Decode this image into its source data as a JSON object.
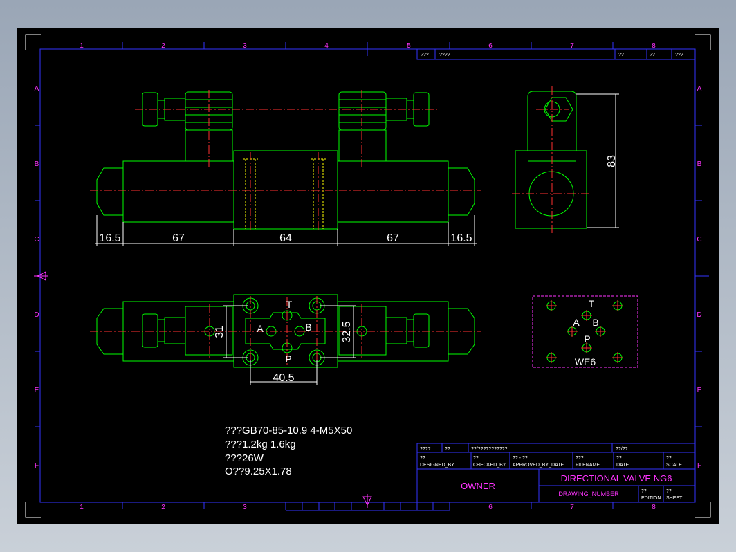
{
  "zone_numbers": [
    "1",
    "2",
    "3",
    "4",
    "5",
    "6",
    "7",
    "8"
  ],
  "zone_letters": [
    "A",
    "B",
    "C",
    "D",
    "E",
    "F"
  ],
  "title_top": {
    "c1": "???",
    "c2": "????",
    "c3": "??",
    "c4": "??",
    "c5": "???"
  },
  "dimensions": {
    "front": [
      "16.5",
      "67",
      "64",
      "67",
      "16.5"
    ],
    "side_height": "83",
    "plan_31": "31",
    "plan_32_5": "32.5",
    "plan_40_5": "40.5"
  },
  "port_labels": {
    "T": "T",
    "A": "A",
    "B": "B",
    "P": "P"
  },
  "symbol_name": "WE6",
  "notes": [
    "???GB70-85-10.9  4-M5X50",
    "???1.2kg   1.6kg",
    "???26W",
    "O??9.25X1.78"
  ],
  "title_block": {
    "r1": [
      "????",
      "??",
      "??/???????????",
      "??/??"
    ],
    "r2_top": [
      "??",
      "??",
      "?? - ??",
      "???",
      "??",
      "??"
    ],
    "r2_bot": [
      "DESIGNED_BY",
      "CHECKED_BY",
      "APPROVED_BY_DATE",
      "FILENAME",
      "DATE",
      "SCALE"
    ],
    "owner": "OWNER",
    "title": "DIRECTIONAL VALVE NG6",
    "drawing_number": "DRAWING_NUMBER",
    "edition_top": "??",
    "edition": "EDITION",
    "sheet_top": "??",
    "sheet": "SHEET"
  },
  "colors": {
    "part": "#00ff00",
    "center": "#ff3030",
    "border": "#3333ff",
    "label": "#ff33ff",
    "text": "#ffffff",
    "hidden": "#ffff00"
  }
}
